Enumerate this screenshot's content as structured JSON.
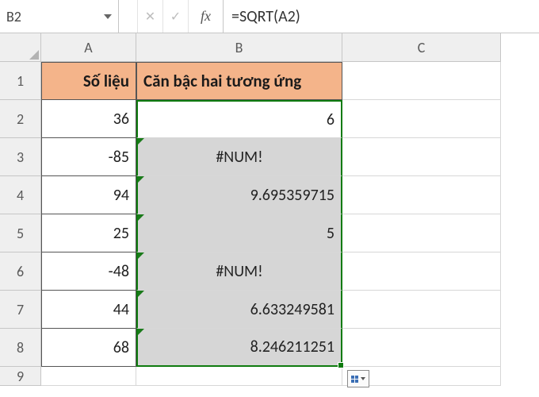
{
  "name_box": {
    "cell_ref": "B2"
  },
  "formula_bar": {
    "cancel_glyph": "✕",
    "enter_glyph": "✓",
    "fx_label": "fx",
    "formula": "=SQRT(A2)"
  },
  "column_headers": [
    "A",
    "B",
    "C"
  ],
  "row_headers": [
    "1",
    "2",
    "3",
    "4",
    "5",
    "6",
    "7",
    "8",
    "9"
  ],
  "table": {
    "header_row": {
      "a": "Số liệu",
      "b": "Căn bậc hai tương ứng"
    },
    "rows": [
      {
        "a": "36",
        "b": "6",
        "b_err": false
      },
      {
        "a": "-85",
        "b": "#NUM!",
        "b_err": true
      },
      {
        "a": "94",
        "b": "9.695359715",
        "b_err": false
      },
      {
        "a": "25",
        "b": "5",
        "b_err": false
      },
      {
        "a": "-48",
        "b": "#NUM!",
        "b_err": true
      },
      {
        "a": "44",
        "b": "6.633249581",
        "b_err": false
      },
      {
        "a": "68",
        "b": "8.246211251",
        "b_err": false
      }
    ]
  }
}
